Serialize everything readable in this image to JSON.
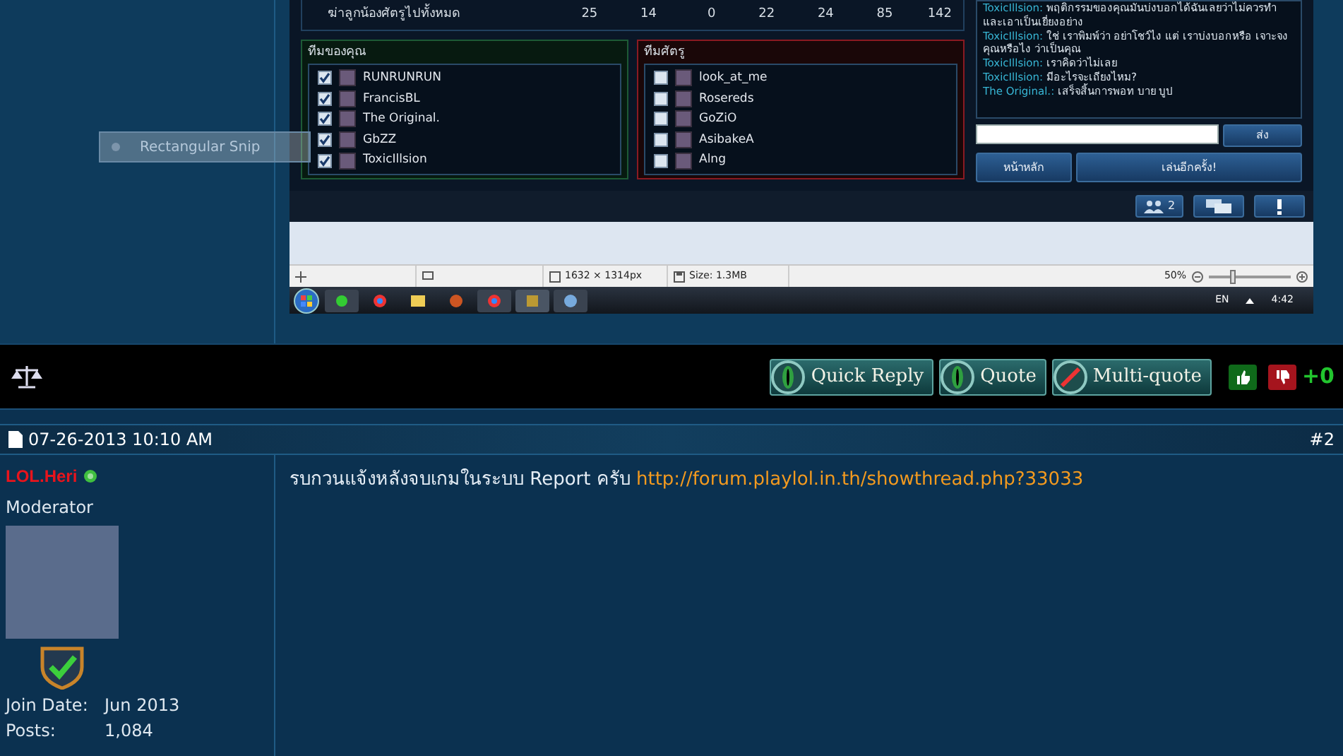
{
  "embedded_screenshot": {
    "stats_row": {
      "label": "ฆ่าลูกน้องศัตรูไปทั้งหมด",
      "values": [
        "25",
        "14",
        "0",
        "22",
        "24",
        "85",
        "142"
      ]
    },
    "teams": [
      {
        "title": "ทีมของคุณ",
        "kind": "ally",
        "players": [
          {
            "name": "RUNRUNRUN",
            "checked": true
          },
          {
            "name": "FrancisBL",
            "checked": true
          },
          {
            "name": "The Original.",
            "checked": true
          },
          {
            "name": "GbZZ",
            "checked": true
          },
          {
            "name": "ToxicIllsion",
            "checked": true
          }
        ]
      },
      {
        "title": "ทีมศัตรู",
        "kind": "enemy",
        "players": [
          {
            "name": "look_at_me",
            "checked": false
          },
          {
            "name": "Rosereds",
            "checked": false
          },
          {
            "name": "GoZiO",
            "checked": false
          },
          {
            "name": "AsibakeA",
            "checked": false
          },
          {
            "name": "Alng",
            "checked": false
          }
        ]
      }
    ],
    "chat": {
      "messages": [
        {
          "sender": "ToxicIllsion:",
          "text": "พฤติกรรมของคุณมันบ่งบอกได้ฉันเลยว่าไม่ควรทำและเอาเป็นเยี่ยงอย่าง"
        },
        {
          "sender": "ToxicIllsion:",
          "text": "ใช่ เราพิมพ์ว่า อย่าโชว์ไง แต่ เราบ่งบอกหรือ เจาะจงคุณหรือไง ว่าเป็นคุณ"
        },
        {
          "sender": "ToxicIllsion:",
          "text": "เราคิดว่าไม่เลย"
        },
        {
          "sender": "ToxicIllsion:",
          "text": "มีอะไรจะเถียงไหม?"
        },
        {
          "sender": "The Original.:",
          "text": "เสร็จสิ้นการพอท บาย บูป"
        }
      ],
      "send_button": "ส่ง"
    },
    "nav_buttons": [
      "หน้าหลัก",
      "เล่นอีกครั้ง!"
    ],
    "friends_count": "2",
    "viewer_status": {
      "dimensions": "1632 × 1314px",
      "size": "Size: 1.3MB",
      "zoom": "50%",
      "zoom_slider": {
        "level": 0.3
      }
    },
    "taskbar": {
      "language": "EN",
      "time": "4:42"
    }
  },
  "snip_tooltip": "Rectangular Snip",
  "post_actions": {
    "buttons": [
      "Quick Reply",
      "Quote",
      "Multi-quote"
    ],
    "score": "+0"
  },
  "post": {
    "date": "07-26-2013 10:10 AM",
    "number": "#2",
    "author": {
      "name": "LOL.Heri",
      "online": true,
      "title": "Moderator",
      "fields": [
        {
          "label": "Join Date:",
          "value": "Jun 2013"
        },
        {
          "label": "Posts:",
          "value": "1,084"
        }
      ]
    },
    "message": "รบกวนแจ้งหลังจบเกมในระบบ Report ครับ",
    "link": "http://forum.playlol.in.th/showthread.php?33033"
  }
}
